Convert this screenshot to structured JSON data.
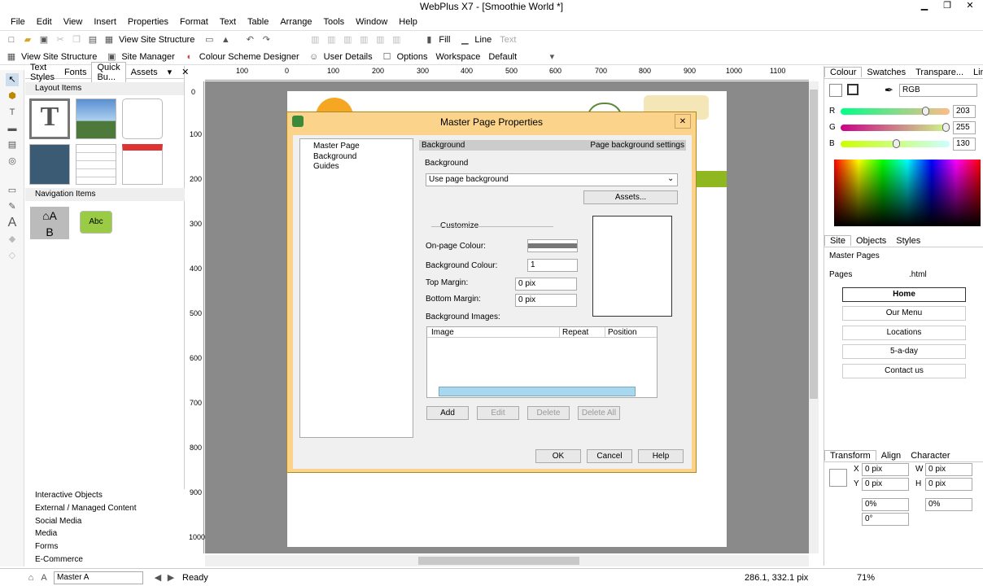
{
  "window": {
    "title": "WebPlus X7 - [Smoothie World *]",
    "min": "▁",
    "max": "❐",
    "close": "✕"
  },
  "menu": [
    "File",
    "Edit",
    "View",
    "Insert",
    "Properties",
    "Format",
    "Text",
    "Table",
    "Arrange",
    "Tools",
    "Window",
    "Help"
  ],
  "toolbar1": {
    "view_site_structure": "View Site Structure",
    "fill": "Fill",
    "line": "Line",
    "text": "Text"
  },
  "toolbar2": {
    "view_site_structure": "View Site Structure",
    "site_manager": "Site Manager",
    "colour_scheme": "Colour Scheme Designer",
    "user_details": "User Details",
    "options": "Options",
    "workspace_label": "Workspace",
    "workspace_value": "Default"
  },
  "left_panel": {
    "tabs": [
      "Text Styles",
      "Fonts",
      "Quick Bu...",
      "Assets"
    ],
    "layout_items": "Layout Items",
    "navigation_items": "Navigation Items",
    "nav_button": "Abc",
    "categories": [
      "Interactive Objects",
      "External / Managed Content",
      "Social Media",
      "Media",
      "Forms",
      "E-Commerce"
    ]
  },
  "ruler_h": [
    "100",
    "0",
    "100",
    "200",
    "300",
    "400",
    "500",
    "600",
    "700",
    "800",
    "900",
    "1000",
    "1100"
  ],
  "ruler_v": [
    "0",
    "100",
    "200",
    "300",
    "400",
    "500",
    "600",
    "700",
    "800",
    "900",
    "1000"
  ],
  "dialog": {
    "title": "Master Page Properties",
    "tree": [
      "Master Page",
      "Background",
      "Guides"
    ],
    "section_title": "Background",
    "section_hint": "Page background settings",
    "background_label": "Background",
    "background_value": "Use page background",
    "assets_button": "Assets...",
    "customize_label": "Customize",
    "on_page_colour_label": "On-page Colour:",
    "bg_colour_label": "Background Colour:",
    "bg_colour_value": "1",
    "top_margin_label": "Top Margin:",
    "top_margin_value": "0 pix",
    "bottom_margin_label": "Bottom Margin:",
    "bottom_margin_value": "0 pix",
    "bg_images_label": "Background Images:",
    "columns": [
      "Image",
      "Repeat",
      "Position"
    ],
    "add": "Add",
    "edit": "Edit",
    "delete": "Delete",
    "delete_all": "Delete All",
    "ok": "OK",
    "cancel": "Cancel",
    "help": "Help"
  },
  "colour_panel": {
    "tabs": [
      "Colour",
      "Swatches",
      "Transpare...",
      "Line"
    ],
    "model": "RGB",
    "r": {
      "label": "R",
      "value": "203",
      "level": 0.796
    },
    "g": {
      "label": "G",
      "value": "255",
      "level": 1.0
    },
    "b": {
      "label": "B",
      "value": "130",
      "level": 0.51
    }
  },
  "site_panel": {
    "tabs": [
      "Site",
      "Objects",
      "Styles"
    ],
    "master_pages": "Master Pages",
    "pages": "Pages",
    "html": ".html",
    "items": [
      "Home",
      "Our Menu",
      "Locations",
      "5-a-day",
      "Contact us"
    ]
  },
  "transform_panel": {
    "tabs": [
      "Transform",
      "Align",
      "Character"
    ],
    "x_label": "X",
    "x_value": "0 pix",
    "w_label": "W",
    "w_value": "0 pix",
    "y_label": "Y",
    "y_value": "0 pix",
    "h_label": "H",
    "h_value": "0 pix",
    "scale_value": "0%",
    "scale2_value": "0%",
    "rotate_value": "0°"
  },
  "status": {
    "master": "Master A",
    "ready": "Ready",
    "coords": "286.1, 332.1 pix",
    "zoom": "71%"
  }
}
